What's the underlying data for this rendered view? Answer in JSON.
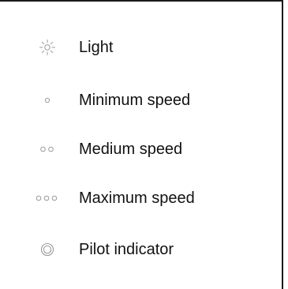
{
  "legend": {
    "items": [
      {
        "icon": "light-icon",
        "label": "Light"
      },
      {
        "icon": "minimum-speed-icon",
        "label": "Minimum speed"
      },
      {
        "icon": "medium-speed-icon",
        "label": "Medium speed"
      },
      {
        "icon": "maximum-speed-icon",
        "label": "Maximum speed"
      },
      {
        "icon": "pilot-indicator-icon",
        "label": "Pilot indicator"
      }
    ]
  },
  "colors": {
    "icon": "#9a9a9a",
    "text": "#111111",
    "border": "#1a1a1a"
  }
}
